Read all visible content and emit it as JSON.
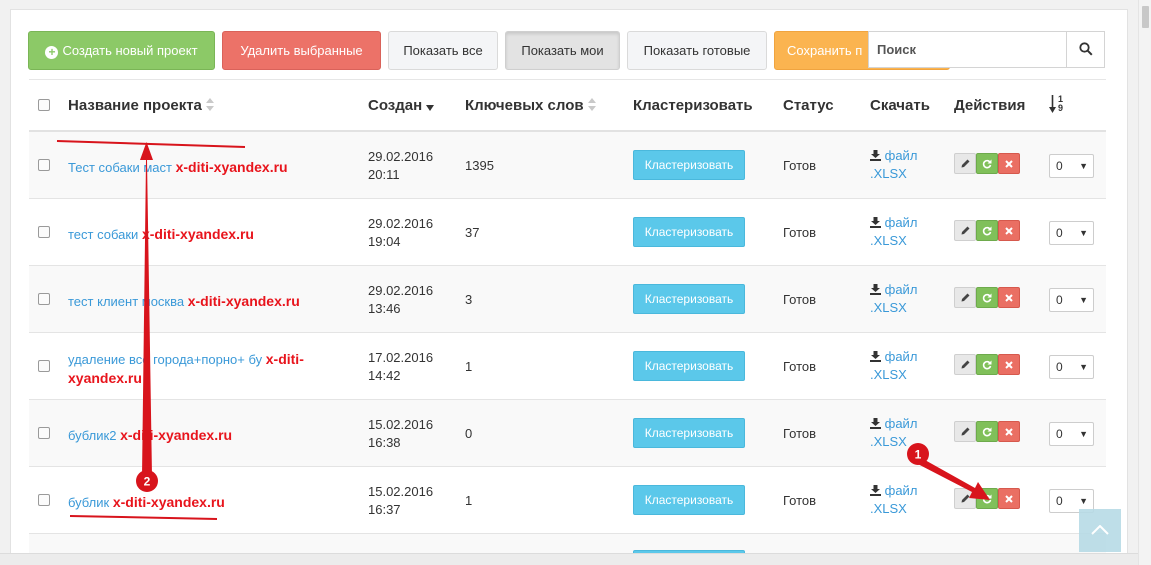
{
  "toolbar": {
    "create_label": "Создать новый проект",
    "delete_label": "Удалить выбранные",
    "show_all_label": "Показать все",
    "show_mine_label": "Показать мои",
    "show_ready_label": "Показать готовые",
    "save_label": "Сохранить п"
  },
  "search": {
    "placeholder": "Поиск",
    "icon": "search-icon"
  },
  "table": {
    "headers": {
      "name": "Название проекта",
      "created": "Создан",
      "keywords": "Ключевых слов",
      "cluster": "Кластеризовать",
      "status": "Статус",
      "download": "Скачать",
      "actions": "Действия",
      "order_top": "1",
      "order_bottom": "9"
    },
    "rows": [
      {
        "name": "Тест собаки маст",
        "domain": "x-diti-xyandex.ru",
        "date": "29.02.2016",
        "time": "20:11",
        "keywords": "1395",
        "cluster": "Кластеризовать",
        "status": "Готов",
        "file": "файл",
        "ext": ".XLSX",
        "order": "0"
      },
      {
        "name": "тест собаки",
        "domain": "x-diti-xyandex.ru",
        "date": "29.02.2016",
        "time": "19:04",
        "keywords": "37",
        "cluster": "Кластеризовать",
        "status": "Готов",
        "file": "файл",
        "ext": ".XLSX",
        "order": "0"
      },
      {
        "name": "тест клиент москва",
        "domain": "x-diti-xyandex.ru",
        "date": "29.02.2016",
        "time": "13:46",
        "keywords": "3",
        "cluster": "Кластеризовать",
        "status": "Готов",
        "file": "файл",
        "ext": ".XLSX",
        "order": "0"
      },
      {
        "name": "удаление все города+порно+ бу",
        "domain": "x-diti-xyandex.ru",
        "date": "17.02.2016",
        "time": "14:42",
        "keywords": "1",
        "cluster": "Кластеризовать",
        "status": "Готов",
        "file": "файл",
        "ext": ".XLSX",
        "order": "0"
      },
      {
        "name": "бублик2",
        "domain": "x-diti-xyandex.ru",
        "date": "15.02.2016",
        "time": "16:38",
        "keywords": "0",
        "cluster": "Кластеризовать",
        "status": "Готов",
        "file": "файл",
        "ext": ".XLSX",
        "order": "0"
      },
      {
        "name": "бублик",
        "domain": "x-diti-xyandex.ru",
        "date": "15.02.2016",
        "time": "16:37",
        "keywords": "1",
        "cluster": "Кластеризовать",
        "status": "Готов",
        "file": "файл",
        "ext": ".XLSX",
        "order": "0"
      }
    ]
  },
  "annotations": {
    "marker_1": "1",
    "marker_2": "2",
    "color": "#e8141c"
  },
  "colors": {
    "accent": "#3a99d8",
    "domain": "#e8141c",
    "cluster_button": "#5bc8ea",
    "create_button": "#8cc967",
    "delete_button": "#ec7268",
    "save_button": "#fbb450"
  }
}
